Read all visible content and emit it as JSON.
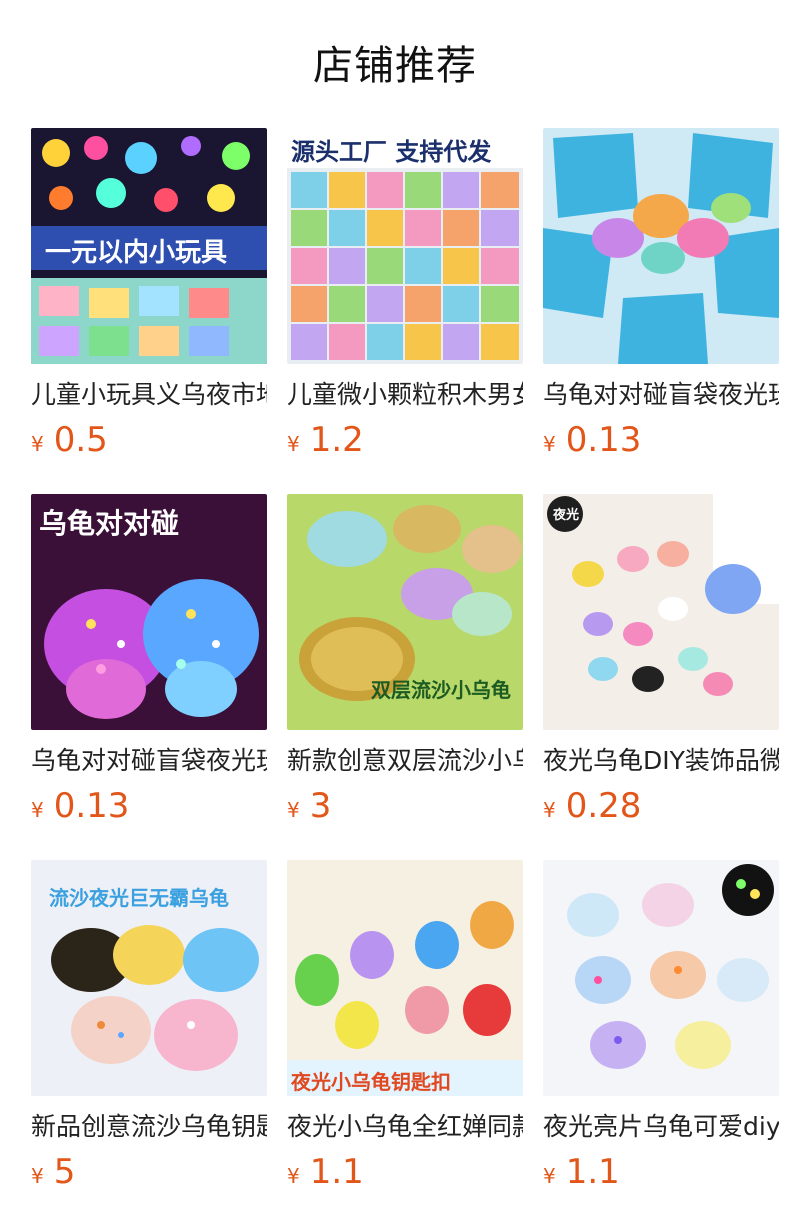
{
  "page": {
    "title": "店铺推荐"
  },
  "currency_symbol": "¥",
  "products": [
    {
      "title": "儿童小玩具义乌夜市地摊货源",
      "price": "0.5",
      "image_overlay": "一元以内小玩具"
    },
    {
      "title": "儿童微小颗粒积木男女孩",
      "price": "1.2",
      "image_overlay": "源头工厂 支持代发"
    },
    {
      "title": "乌龟对对碰盲袋夜光玩具",
      "price": "0.13",
      "image_overlay": ""
    },
    {
      "title": "乌龟对对碰盲袋夜光玩具",
      "price": "0.13",
      "image_overlay": "乌龟对对碰"
    },
    {
      "title": "新款创意双层流沙小乌龟",
      "price": "3",
      "image_overlay": "双层流沙小乌龟"
    },
    {
      "title": "夜光乌龟DIY装饰品微景观",
      "price": "0.28",
      "image_overlay": "夜光"
    },
    {
      "title": "新品创意流沙乌龟钥匙扣",
      "price": "5",
      "image_overlay": "流沙夜光巨无霸乌龟"
    },
    {
      "title": "夜光小乌龟全红婵同款钥匙扣",
      "price": "1.1",
      "image_overlay": "夜光小乌龟钥匙扣"
    },
    {
      "title": "夜光亮片乌龟可爱diy饰品",
      "price": "1.1",
      "image_overlay": ""
    }
  ]
}
